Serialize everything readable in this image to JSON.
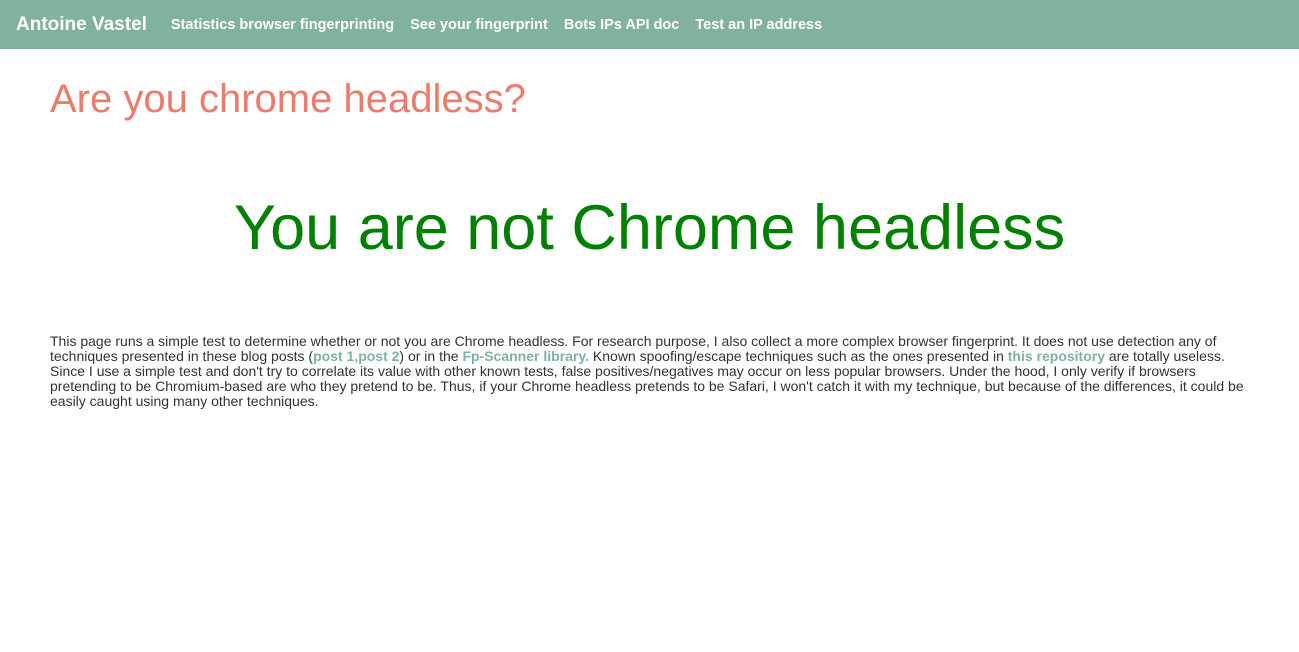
{
  "colors": {
    "navbar_bg": "#80b29c",
    "navbar_text": "#ffffff",
    "title": "#ed7b6c",
    "result": "#008000",
    "link": "#80b29c",
    "body_text": "#333333"
  },
  "navbar": {
    "brand": "Antoine Vastel",
    "links": [
      "Statistics browser fingerprinting",
      "See your fingerprint",
      "Bots IPs API doc",
      "Test an IP address"
    ]
  },
  "main": {
    "title": "Are you chrome headless?",
    "result": "You are not Chrome headless",
    "description": {
      "part1": "This page runs a simple test to determine whether or not you are Chrome headless. For research purpose, I also collect a more complex browser fingerprint. It does not use detection any of techniques presented in these blog posts (",
      "link_post1": "post 1",
      "comma": ",",
      "link_post2": "post 2",
      "part2": ") or in the ",
      "link_fpscanner": "Fp-Scanner library.",
      "part3": " Known spoofing/escape techniques such as the ones presented in ",
      "link_repository": "this repository",
      "part4": " are totally useless. Since I use a simple test and don't try to correlate its value with other known tests, false positives/negatives may occur on less popular browsers. Under the hood, I only verify if browsers pretending to be Chromium-based are who they pretend to be. Thus, if your Chrome headless pretends to be Safari, I won't catch it with my technique, but because of the differences, it could be easily caught using many other techniques."
    }
  }
}
